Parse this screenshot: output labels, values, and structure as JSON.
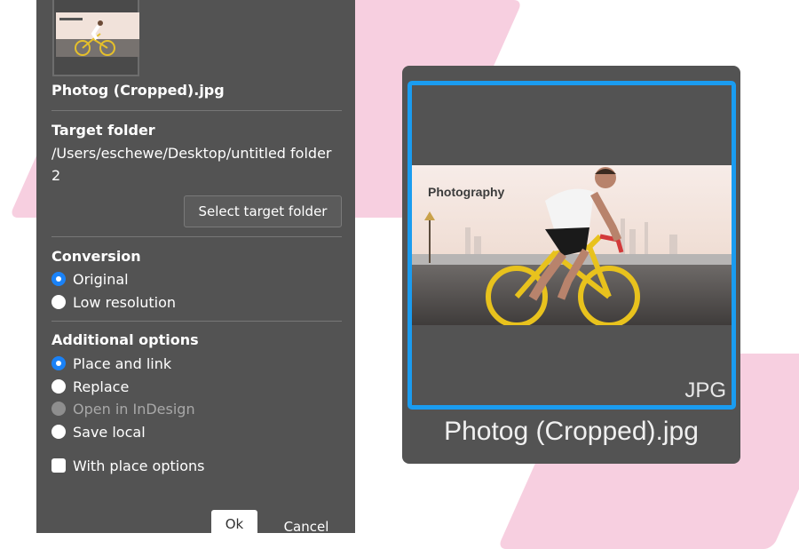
{
  "panel": {
    "filename": "Photog (Cropped).jpg",
    "target_folder": {
      "title": "Target folder",
      "path": "/Users/eschewe/Desktop/untitled folder 2",
      "select_button": "Select target folder"
    },
    "conversion": {
      "title": "Conversion",
      "options": [
        {
          "label": "Original",
          "checked": true
        },
        {
          "label": "Low resolution",
          "checked": false
        }
      ]
    },
    "additional": {
      "title": "Additional options",
      "options": [
        {
          "label": "Place and link",
          "checked": true
        },
        {
          "label": "Replace",
          "checked": false
        },
        {
          "label": "Open in InDesign",
          "checked": false,
          "disabled": true
        },
        {
          "label": "Save local",
          "checked": false
        }
      ],
      "checkbox_label": "With place options"
    },
    "ok_label": "Ok",
    "cancel_label": "Cancel"
  },
  "preview": {
    "photo_text": "Photography",
    "format_tag": "JPG",
    "caption": "Photog (Cropped).jpg"
  },
  "colors": {
    "panel_bg": "#535353",
    "accent_blue": "#1a9cf0",
    "background_pink": "#f7cfe0"
  }
}
